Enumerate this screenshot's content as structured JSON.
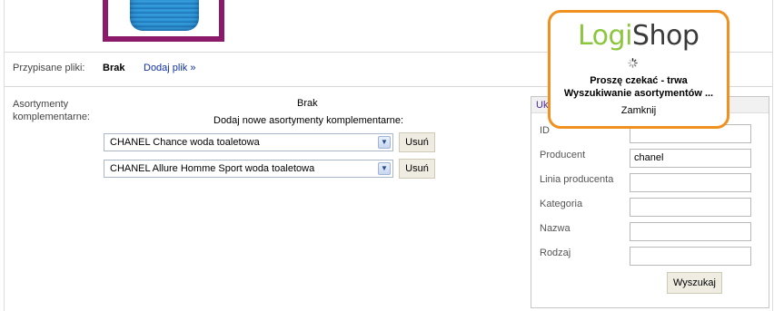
{
  "files": {
    "label": "Przypisane pliki:",
    "value": "Brak",
    "add_link": "Dodaj plik »"
  },
  "complementary": {
    "label": "Asortymenty komplementarne:",
    "value": "Brak",
    "add_new": "Dodaj nowe asortymenty komplementarne:",
    "items": [
      {
        "selected": "CHANEL Chance woda toaletowa",
        "remove_label": "Usuń"
      },
      {
        "selected": "CHANEL Allure Homme Sport woda toaletowa",
        "remove_label": "Usuń"
      }
    ]
  },
  "search_panel": {
    "title": "Uk",
    "fields": [
      {
        "label": "ID",
        "value": ""
      },
      {
        "label": "Producent",
        "value": "chanel"
      },
      {
        "label": "Linia producenta",
        "value": ""
      },
      {
        "label": "Kategoria",
        "value": ""
      },
      {
        "label": "Nazwa",
        "value": ""
      },
      {
        "label": "Rodzaj",
        "value": ""
      }
    ],
    "search_button": "Wyszukaj"
  },
  "popup": {
    "logo_part1": "Logi",
    "logo_part2": "Shop",
    "line1": "Proszę czekać - trwa",
    "line2": "Wyszukiwanie asortymentów ...",
    "close_label": "Zamknij"
  },
  "colors": {
    "popup_border": "#f0901e",
    "logo_green": "#8cc63f",
    "thumb_frame": "#8b1a6b"
  }
}
